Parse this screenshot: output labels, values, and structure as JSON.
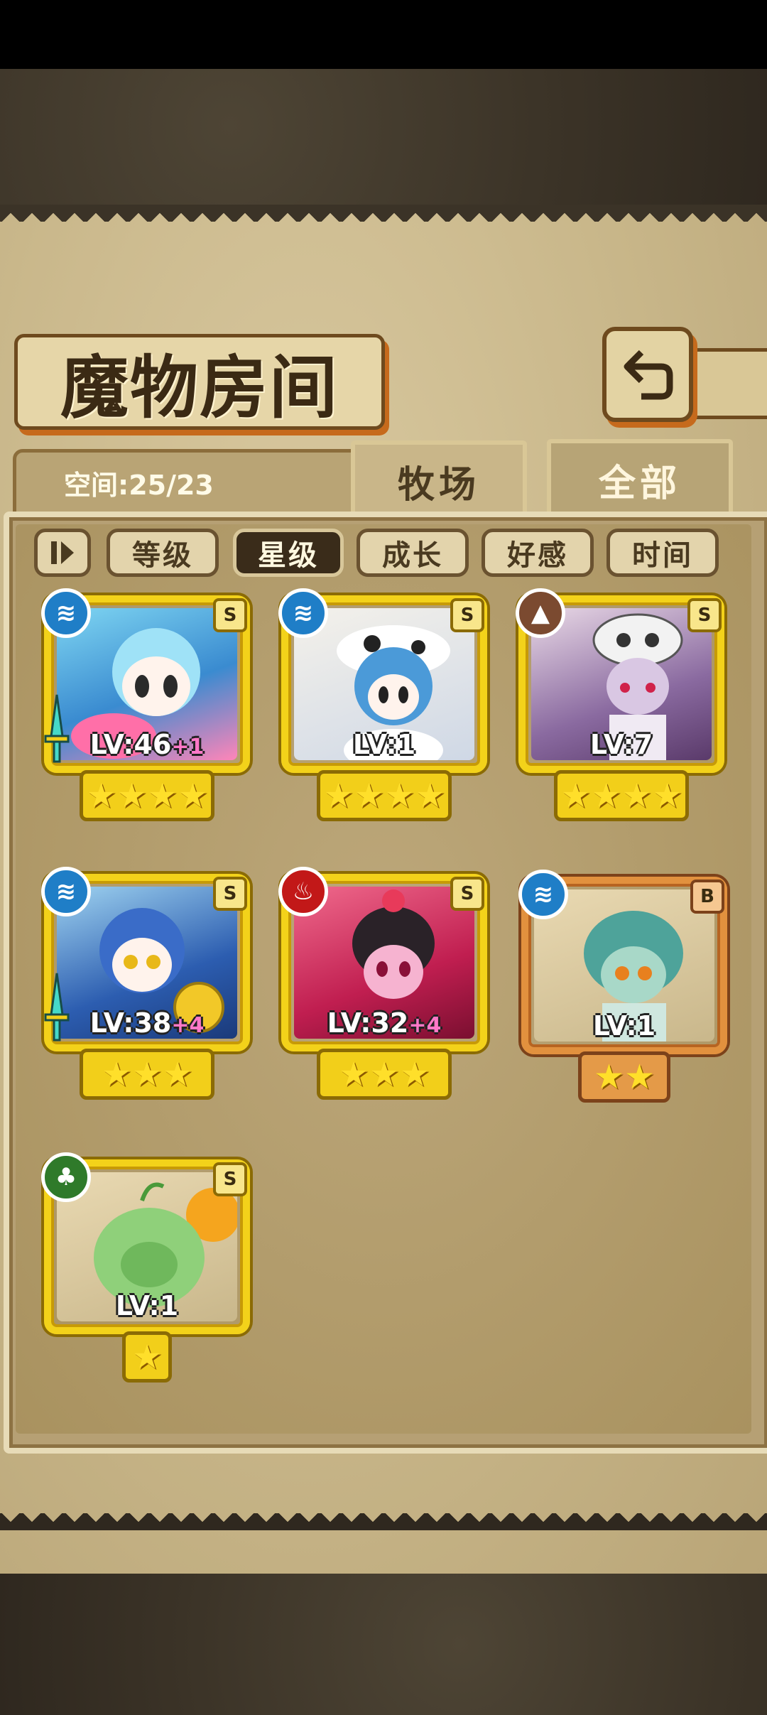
{
  "title": "魔物房间",
  "space_label": "空间:25/23",
  "tabs": [
    {
      "label": "牧场",
      "active": true
    },
    {
      "label": "全部",
      "active": false
    }
  ],
  "sort_buttons": [
    {
      "label": "等级",
      "active": false
    },
    {
      "label": "星级",
      "active": true
    },
    {
      "label": "成长",
      "active": false
    },
    {
      "label": "好感",
      "active": false
    },
    {
      "label": "时间",
      "active": false
    }
  ],
  "cards": [
    {
      "rank": "S",
      "element": "water",
      "level": "LV:46",
      "bonus": "+1",
      "stars": 4,
      "equipped": true
    },
    {
      "rank": "S",
      "element": "water",
      "level": "LV:1",
      "bonus": "",
      "stars": 4,
      "equipped": false
    },
    {
      "rank": "S",
      "element": "earth",
      "level": "LV:7",
      "bonus": "",
      "stars": 4,
      "equipped": false
    },
    {
      "rank": "S",
      "element": "water",
      "level": "LV:38",
      "bonus": "+4",
      "stars": 3,
      "equipped": true
    },
    {
      "rank": "S",
      "element": "fire",
      "level": "LV:32",
      "bonus": "+4",
      "stars": 3,
      "equipped": false
    },
    {
      "rank": "B",
      "element": "water",
      "level": "LV:1",
      "bonus": "",
      "stars": 2,
      "equipped": false
    },
    {
      "rank": "S",
      "element": "wood",
      "level": "LV:1",
      "bonus": "",
      "stars": 1,
      "equipped": false
    }
  ],
  "colors": {
    "rank_s": "#f3d21a",
    "rank_b": "#e2913e",
    "water": "#1f7ec7",
    "earth": "#7b4a30",
    "fire": "#c21818",
    "wood": "#2f7a2a"
  }
}
